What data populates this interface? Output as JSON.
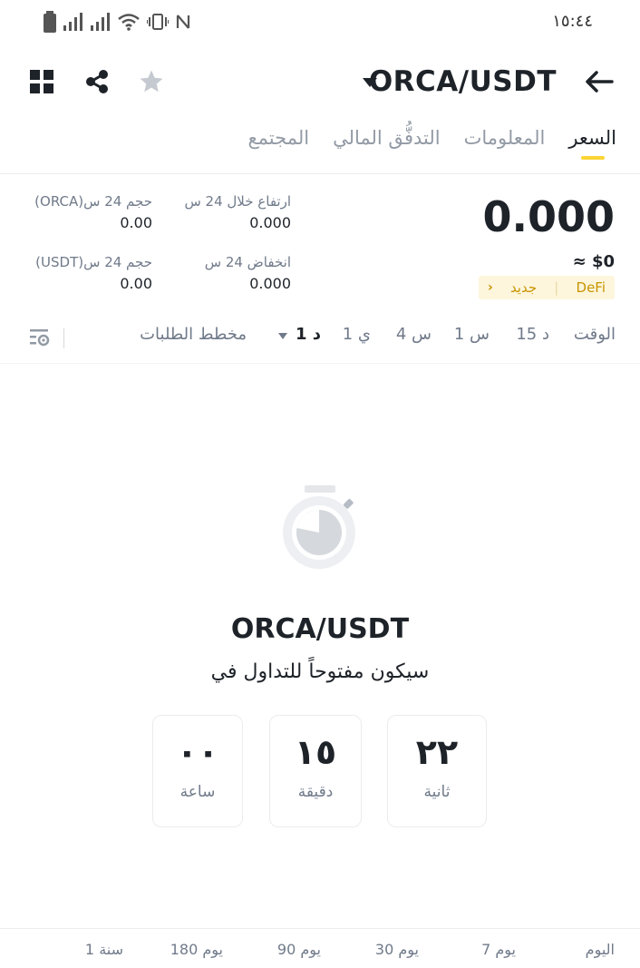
{
  "status_bar": {
    "time": "١٥:٤٤"
  },
  "header": {
    "pair": "ORCA/USDT"
  },
  "tabs": [
    {
      "label": "السعر",
      "active": true
    },
    {
      "label": "المعلومات",
      "active": false
    },
    {
      "label": "التدفُّق المالي",
      "active": false
    },
    {
      "label": "المجتمع",
      "active": false
    }
  ],
  "price": {
    "last": "0.000",
    "fiat": "≈ $0",
    "tag_defi": "DeFi",
    "tag_new": "جديد"
  },
  "stats": {
    "high_label": "ارتفاع خلال 24 س",
    "high_value": "0.000",
    "low_label": "انخفاض 24 س",
    "low_value": "0.000",
    "vol_base_label": "حجم 24 س(ORCA)",
    "vol_base_value": "0.00",
    "vol_quote_label": "حجم 24 س(USDT)",
    "vol_quote_value": "0.00"
  },
  "intervals": {
    "time": "الوقت",
    "m15": "15 د",
    "h1": "1 س",
    "h4": "4 س",
    "d1": "1 ي",
    "selected": "1 د",
    "order_book": "مخطط الطلبات"
  },
  "countdown": {
    "title": "ORCA/USDT",
    "subtitle": "سيكون مفتوحاً للتداول في",
    "seconds_value": "٢٢",
    "seconds_label": "ثانية",
    "minutes_value": "١٥",
    "minutes_label": "دقيقة",
    "hours_value": "٠٠",
    "hours_label": "ساعة"
  },
  "periods": {
    "today": "اليوم",
    "d7": "7 يوم",
    "d30": "30 يوم",
    "d90": "90 يوم",
    "d180": "180 يوم",
    "y1": "1 سنة"
  },
  "colors": {
    "accent": "#fcd535",
    "tag_bg": "#fdf6dc",
    "tag_text": "#c99400"
  }
}
